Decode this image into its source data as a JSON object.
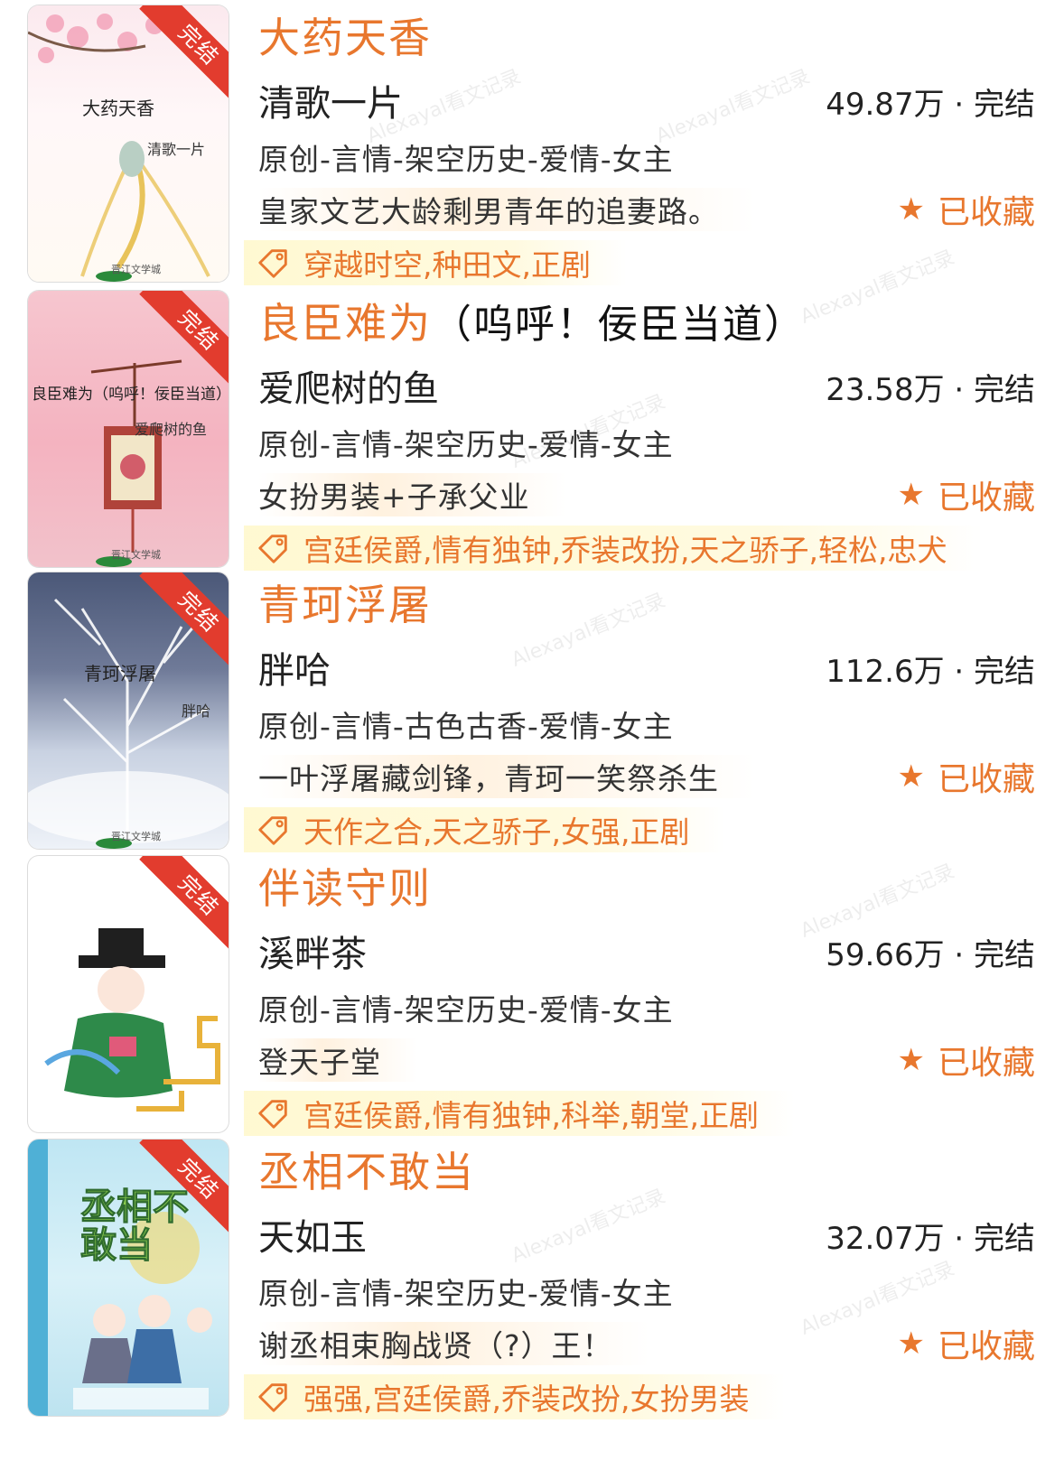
{
  "status_badge": "完结",
  "collect_label": "已收藏",
  "watermark": "Alexayal看文记录",
  "colors": {
    "accent": "#e8772e",
    "ribbon": "#e23c2e"
  },
  "books": [
    {
      "title": "大药天香",
      "subtitle": "",
      "author": "清歌一片",
      "stats": "49.87万 · 完结",
      "category": "原创-言情-架空历史-爱情-女主",
      "summary": "皇家文艺大龄剩男青年的追妻路。",
      "tags": "穿越时空,种田文,正剧",
      "cover": {
        "title": "大药天香",
        "author": "清歌一片",
        "brand": "晋江文学城"
      }
    },
    {
      "title": "良臣难为",
      "subtitle": "（呜呼！佞臣当道）",
      "author": "爱爬树的鱼",
      "stats": "23.58万 · 完结",
      "category": "原创-言情-架空历史-爱情-女主",
      "summary": "女扮男装+子承父业",
      "tags": "宫廷侯爵,情有独钟,乔装改扮,天之骄子,轻松,忠犬",
      "cover": {
        "title": "良臣难为（呜呼！佞臣当道）",
        "author": "爱爬树的鱼",
        "brand": "晋江文学城"
      }
    },
    {
      "title": "青珂浮屠",
      "subtitle": "",
      "author": "胖哈",
      "stats": "112.6万 · 完结",
      "category": "原创-言情-古色古香-爱情-女主",
      "summary": "一叶浮屠藏剑锋，青珂一笑祭杀生",
      "tags": "天作之合,天之骄子,女强,正剧",
      "cover": {
        "title": "青珂浮屠",
        "author": "胖哈",
        "brand": "晋江文学城"
      }
    },
    {
      "title": "伴读守则",
      "subtitle": "",
      "author": "溪畔茶",
      "stats": "59.66万 · 完结",
      "category": "原创-言情-架空历史-爱情-女主",
      "summary": "登天子堂",
      "tags": "宫廷侯爵,情有独钟,科举,朝堂,正剧",
      "cover": {
        "title": "",
        "author": "",
        "brand": ""
      }
    },
    {
      "title": "丞相不敢当",
      "subtitle": "",
      "author": "天如玉",
      "stats": "32.07万 · 完结",
      "category": "原创-言情-架空历史-爱情-女主",
      "summary": "谢丞相束胸战贤（?）王！",
      "tags": "强强,宫廷侯爵,乔装改扮,女扮男装",
      "cover": {
        "title": "丞相不敢当",
        "author": "",
        "brand": ""
      }
    }
  ]
}
